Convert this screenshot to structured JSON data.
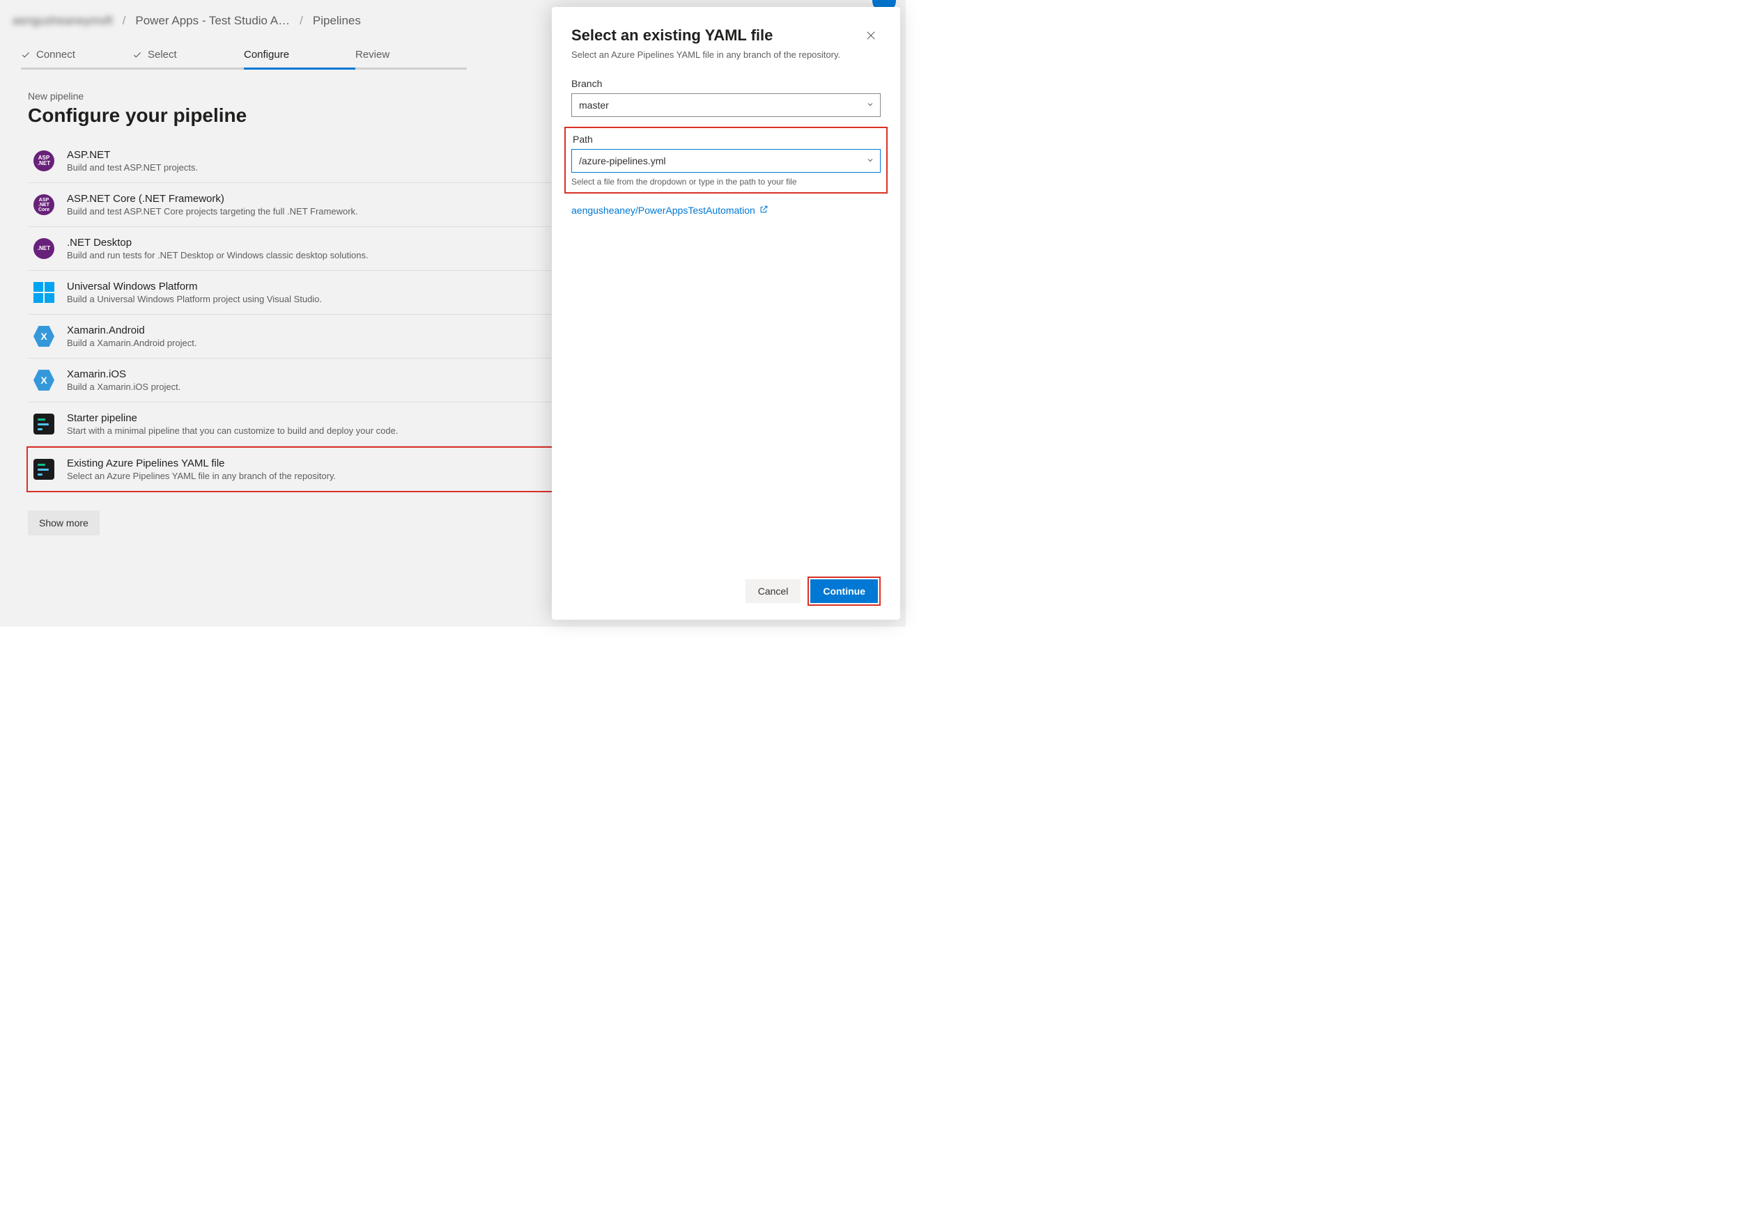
{
  "breadcrumb": {
    "org": "aengusheaneymsft",
    "project": "Power Apps - Test Studio A…",
    "page": "Pipelines"
  },
  "steps": {
    "connect": "Connect",
    "select": "Select",
    "configure": "Configure",
    "review": "Review"
  },
  "subhead": "New pipeline",
  "title": "Configure your pipeline",
  "options": [
    {
      "title": "ASP.NET",
      "desc": "Build and test ASP.NET projects.",
      "icon": "aspnet",
      "icon_label": "ASP .NET"
    },
    {
      "title": "ASP.NET Core (.NET Framework)",
      "desc": "Build and test ASP.NET Core projects targeting the full .NET Framework.",
      "icon": "aspnetcore",
      "icon_label": "ASP .NET Core"
    },
    {
      "title": ".NET Desktop",
      "desc": "Build and run tests for .NET Desktop or Windows classic desktop solutions.",
      "icon": "netdesktop",
      "icon_label": ".NET"
    },
    {
      "title": "Universal Windows Platform",
      "desc": "Build a Universal Windows Platform project using Visual Studio.",
      "icon": "windows"
    },
    {
      "title": "Xamarin.Android",
      "desc": "Build a Xamarin.Android project.",
      "icon": "xamarin"
    },
    {
      "title": "Xamarin.iOS",
      "desc": "Build a Xamarin.iOS project.",
      "icon": "xamarin"
    },
    {
      "title": "Starter pipeline",
      "desc": "Start with a minimal pipeline that you can customize to build and deploy your code.",
      "icon": "yaml"
    },
    {
      "title": "Existing Azure Pipelines YAML file",
      "desc": "Select an Azure Pipelines YAML file in any branch of the repository.",
      "icon": "yaml"
    }
  ],
  "show_more": "Show more",
  "panel": {
    "title": "Select an existing YAML file",
    "sub": "Select an Azure Pipelines YAML file in any branch of the repository.",
    "branch_label": "Branch",
    "branch_value": "master",
    "path_label": "Path",
    "path_value": "/azure-pipelines.yml",
    "path_hint": "Select a file from the dropdown or type in the path to your file",
    "repo_link": "aengusheaney/PowerAppsTestAutomation",
    "cancel": "Cancel",
    "continue": "Continue"
  }
}
